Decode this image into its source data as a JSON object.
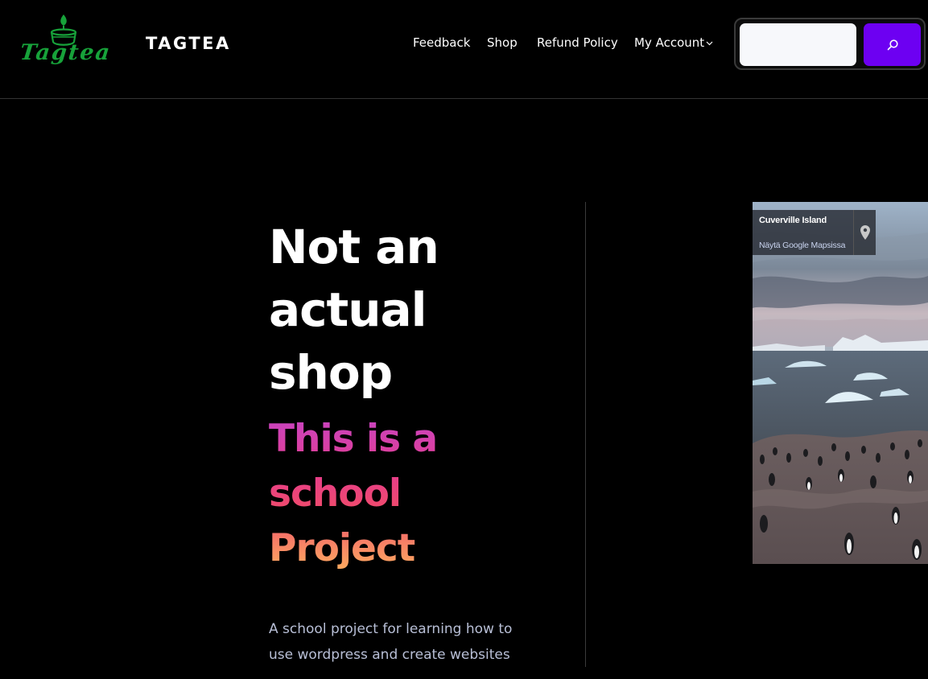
{
  "header": {
    "logo_text": "Tagtea",
    "site_title": "TAGTEA",
    "search_placeholder": ""
  },
  "nav": {
    "items": [
      {
        "label": "Feedback"
      },
      {
        "label": "Shop"
      },
      {
        "label": "Refund Policy"
      },
      {
        "label": "My Account"
      }
    ]
  },
  "hero": {
    "heading": [
      "Not an",
      "actual",
      "shop"
    ],
    "gradient_heading": [
      "This is a",
      "school",
      "Project"
    ],
    "subtitle": "A school project for learning how to use wordpress and create websites"
  },
  "map": {
    "place_name": "Cuverville Island",
    "view_link": "Näytä Google Mapsissa"
  },
  "colors": {
    "background": "#000000",
    "accent": "#6d00f2",
    "logo_green": "#17a23a",
    "gradient_start": "#c544c6",
    "gradient_mid": "#e63d8a",
    "gradient_end": "#ffb45e",
    "subtitle": "#b8bfd6"
  },
  "icons": {
    "search": "search-icon",
    "chevron": "chevron-down-icon",
    "pin": "map-pin-icon",
    "logo": "candle-logo"
  }
}
